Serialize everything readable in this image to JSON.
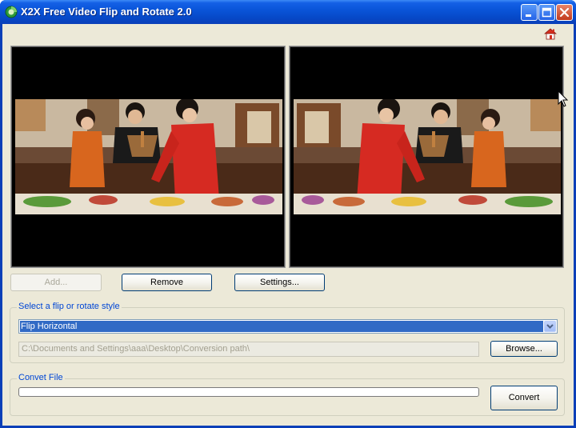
{
  "window": {
    "title": "X2X Free Video Flip and Rotate 2.0",
    "colors": {
      "titlebar": "#0a55d9",
      "client": "#ece9d8",
      "selection": "#316ac5",
      "group_label": "#0046d5"
    }
  },
  "icons": {
    "app": "app-logo-icon",
    "home": "home-icon",
    "minimize": "minimize-icon",
    "maximize": "maximize-icon",
    "close": "close-icon",
    "dropdown": "chevron-down-icon"
  },
  "preview": {
    "left_panel": "original-preview",
    "right_panel": "flipped-preview"
  },
  "buttons": {
    "add": "Add...",
    "remove": "Remove",
    "settings": "Settings...",
    "browse": "Browse...",
    "convert": "Convert"
  },
  "style_group": {
    "label": "Select a flip or rotate style",
    "selected": "Flip Horizontal",
    "output_path": "C:\\Documents and Settings\\aaa\\Desktop\\Conversion path\\"
  },
  "convert_group": {
    "label": "Convet File",
    "progress": 0
  }
}
